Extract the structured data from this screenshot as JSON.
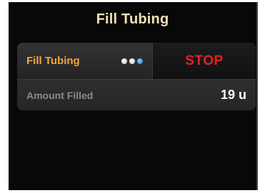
{
  "header": {
    "title": "Fill Tubing"
  },
  "fill_row": {
    "label": "Fill Tubing",
    "progress_dots": 3,
    "active_dot_index": 2,
    "stop_label": "STOP"
  },
  "amount_row": {
    "label": "Amount Filled",
    "value": "19 u"
  },
  "colors": {
    "title": "#f2e2b6",
    "fill_label": "#f0a444",
    "stop": "#e82020",
    "active_dot": "#2b72c8"
  }
}
